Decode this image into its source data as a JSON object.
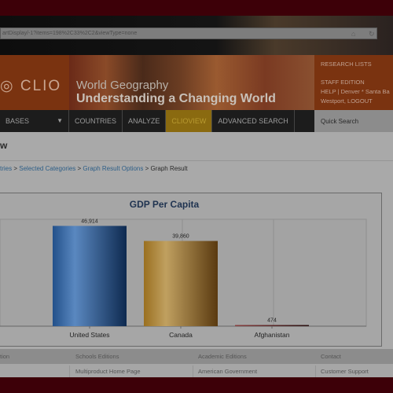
{
  "browser": {
    "address": "artDisplay/-1?items=198%2C33%2C2&viewType=none"
  },
  "banner": {
    "logo": "CLIO",
    "title_line1": "World Geography",
    "title_line2": "Understanding a Changing World",
    "links": [
      "RESEARCH LISTS",
      "STAFF EDITION",
      "HELP | Denver * Santa Ba",
      "Westport, LOGOUT"
    ]
  },
  "nav": {
    "items": [
      {
        "label": "BASES"
      },
      {
        "label": "COUNTRIES"
      },
      {
        "label": "ANALYZE"
      },
      {
        "label": "CLIOVIEW",
        "active": true
      },
      {
        "label": "ADVANCED SEARCH"
      }
    ],
    "quick_search": "Quick Search"
  },
  "page": {
    "title": "w",
    "breadcrumb": [
      {
        "label": "tries",
        "link": true
      },
      {
        "label": "Selected Categories",
        "link": true
      },
      {
        "label": "Graph Result Options",
        "link": true
      },
      {
        "label": "Graph Result",
        "link": false
      }
    ]
  },
  "chart_data": {
    "type": "bar",
    "title": "GDP Per Capita",
    "categories": [
      "United States",
      "Canada",
      "Afghanistan"
    ],
    "values": [
      46914,
      39860,
      474
    ],
    "value_labels": [
      "46,914",
      "39,860",
      "474"
    ],
    "ylim": [
      0,
      50000
    ],
    "grid": true,
    "colors": [
      "#2f5f9a",
      "#a8802e",
      "#6a3030"
    ]
  },
  "footer": {
    "headers": [
      "tion",
      "Schools Editions",
      "Academic Editions",
      "Contact"
    ],
    "row": [
      "",
      "Multiproduct Home Page",
      "American Government",
      "Customer Support"
    ]
  }
}
